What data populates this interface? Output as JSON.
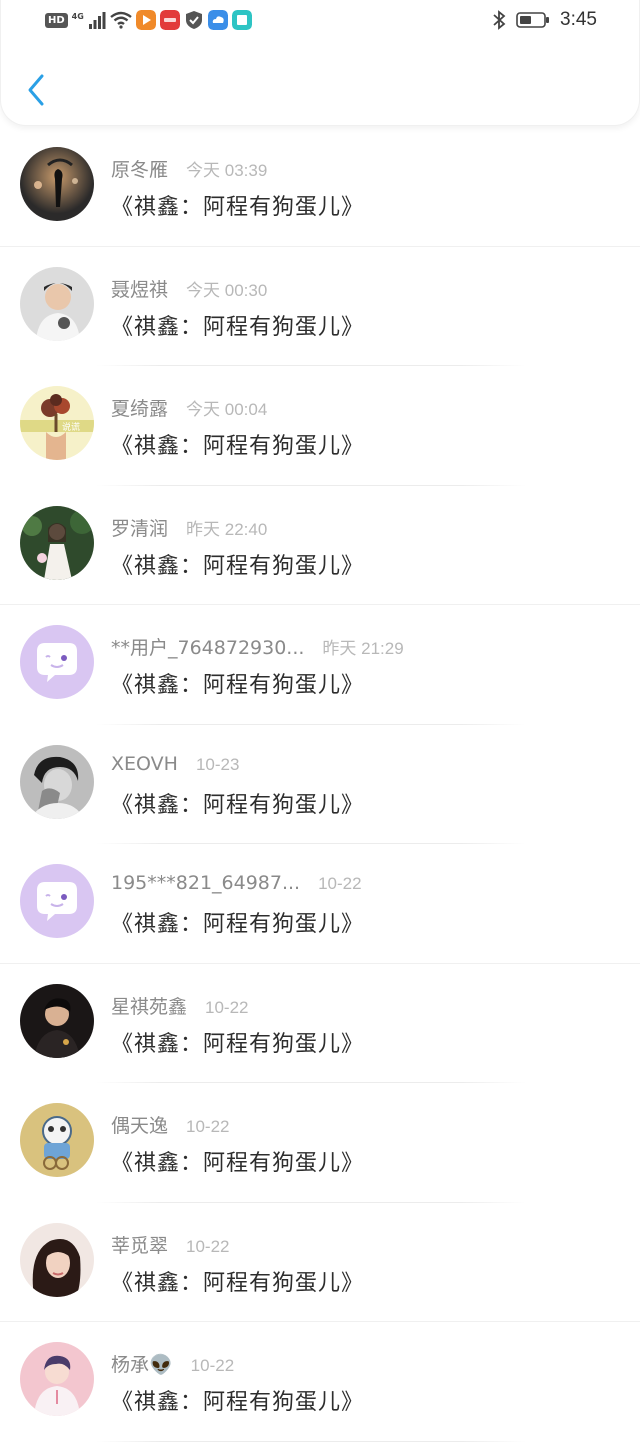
{
  "status_bar": {
    "hd": "HD",
    "network": "4G",
    "time": "3:45"
  },
  "nav": {
    "back_icon": "chevron-left-icon"
  },
  "colors": {
    "accent": "#2aa0e6",
    "default_avatar": "#d9c6f2"
  },
  "messages": [
    {
      "name": "原冬雁",
      "time": "今天 03:39",
      "text": "《祺鑫：阿程有狗蛋儿》",
      "avatar": "photo-dusk"
    },
    {
      "name": "聂煜祺",
      "time": "今天 00:30",
      "text": "《祺鑫：阿程有狗蛋儿》",
      "avatar": "photo-boy"
    },
    {
      "name": "夏绮露",
      "time": "今天 00:04",
      "text": "《祺鑫：阿程有狗蛋儿》",
      "avatar": "photo-flower"
    },
    {
      "name": "罗清润",
      "time": "昨天 22:40",
      "text": "《祺鑫：阿程有狗蛋儿》",
      "avatar": "photo-bride"
    },
    {
      "name": "**用户_764872930...",
      "time": "昨天 21:29",
      "text": "《祺鑫：阿程有狗蛋儿》",
      "avatar": "default-chat"
    },
    {
      "name": "XEOVH",
      "time": "10-23",
      "text": "《祺鑫：阿程有狗蛋儿》",
      "avatar": "photo-bw"
    },
    {
      "name": "195***821_64987...",
      "time": "10-22",
      "text": "《祺鑫：阿程有狗蛋儿》",
      "avatar": "default-chat"
    },
    {
      "name": "星祺苑鑫",
      "time": "10-22",
      "text": "《祺鑫：阿程有狗蛋儿》",
      "avatar": "photo-dark"
    },
    {
      "name": "偶天逸",
      "time": "10-22",
      "text": "《祺鑫：阿程有狗蛋儿》",
      "avatar": "photo-cartoon"
    },
    {
      "name": "莘觅翠",
      "time": "10-22",
      "text": "《祺鑫：阿程有狗蛋儿》",
      "avatar": "photo-girl"
    },
    {
      "name": "杨承👽",
      "time": "10-22",
      "text": "《祺鑫：阿程有狗蛋儿》",
      "avatar": "photo-pink"
    }
  ]
}
